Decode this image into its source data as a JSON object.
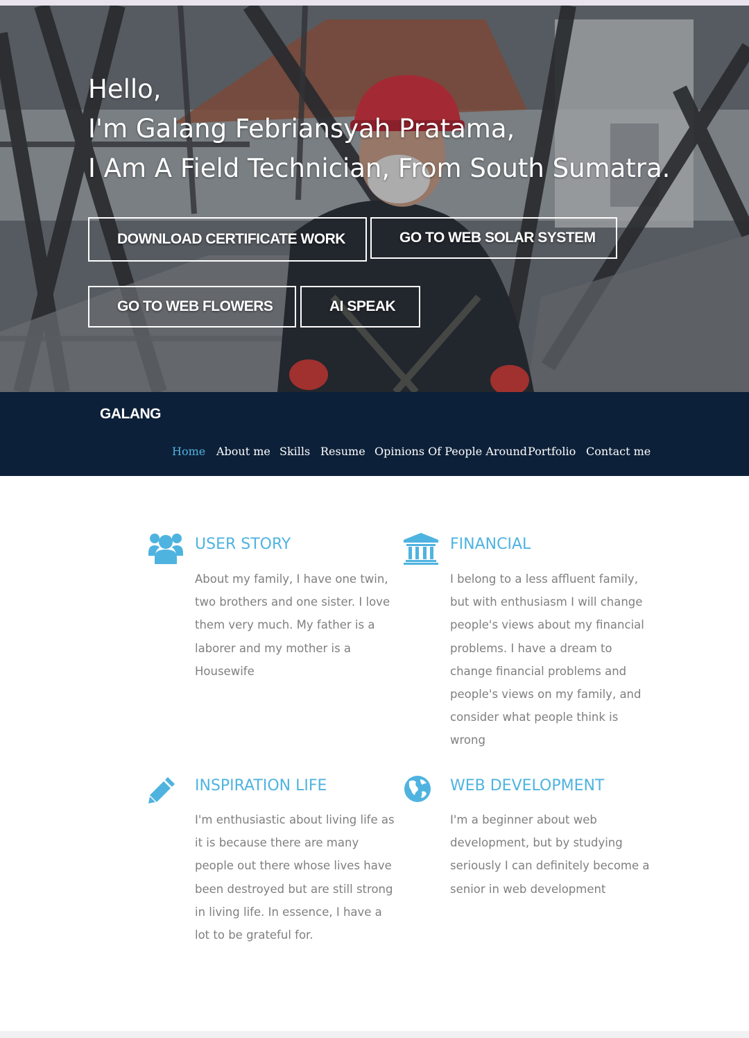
{
  "hero": {
    "greeting": "Hello,",
    "name_line": "I'm Galang Febriansyah Pratama,",
    "role_line": "I Am A Field Technician, From South Sumatra.",
    "buttons": {
      "download_certificate": "DOWNLOAD CERTIFICATE WORK",
      "solar_system": "GO TO WEB SOLAR SYSTEM",
      "flowers": "GO TO WEB FLOWERS",
      "ai_speak": "AI SPEAK"
    }
  },
  "navbar": {
    "brand": "GALANG",
    "items": [
      "Home",
      "About me",
      "Skills",
      "Resume",
      "Opinions Of People Around",
      "Portfolio",
      "Contact me"
    ],
    "active": "Home"
  },
  "features": [
    {
      "icon": "users-icon",
      "title": "USER STORY",
      "body": "About my family, I have one twin, two brothers and one sister. I love them very much. My father is a laborer and my mother is a Housewife"
    },
    {
      "icon": "bank-icon",
      "title": "FINANCIAL",
      "body": "I belong to a less affluent family, but with enthusiasm I will change people's views about my financial problems. I have a dream to change financial problems and people's views on my family, and consider what people think is wrong"
    },
    {
      "icon": "pencil-icon",
      "title": "INSPIRATION LIFE",
      "body": "I'm enthusiastic about living life as it is because there are many people out there whose lives have been destroyed but are still strong in living life. In essence, I have a lot to be grateful for."
    },
    {
      "icon": "globe-icon",
      "title": "WEB DEVELOPMENT",
      "body": "I'm a beginner about web development, but by studying seriously I can definitely become a senior in web development"
    }
  ],
  "colors": {
    "accent": "#4fb3e0",
    "navbar": "#0d2039",
    "body_text": "#7f7f7f"
  }
}
